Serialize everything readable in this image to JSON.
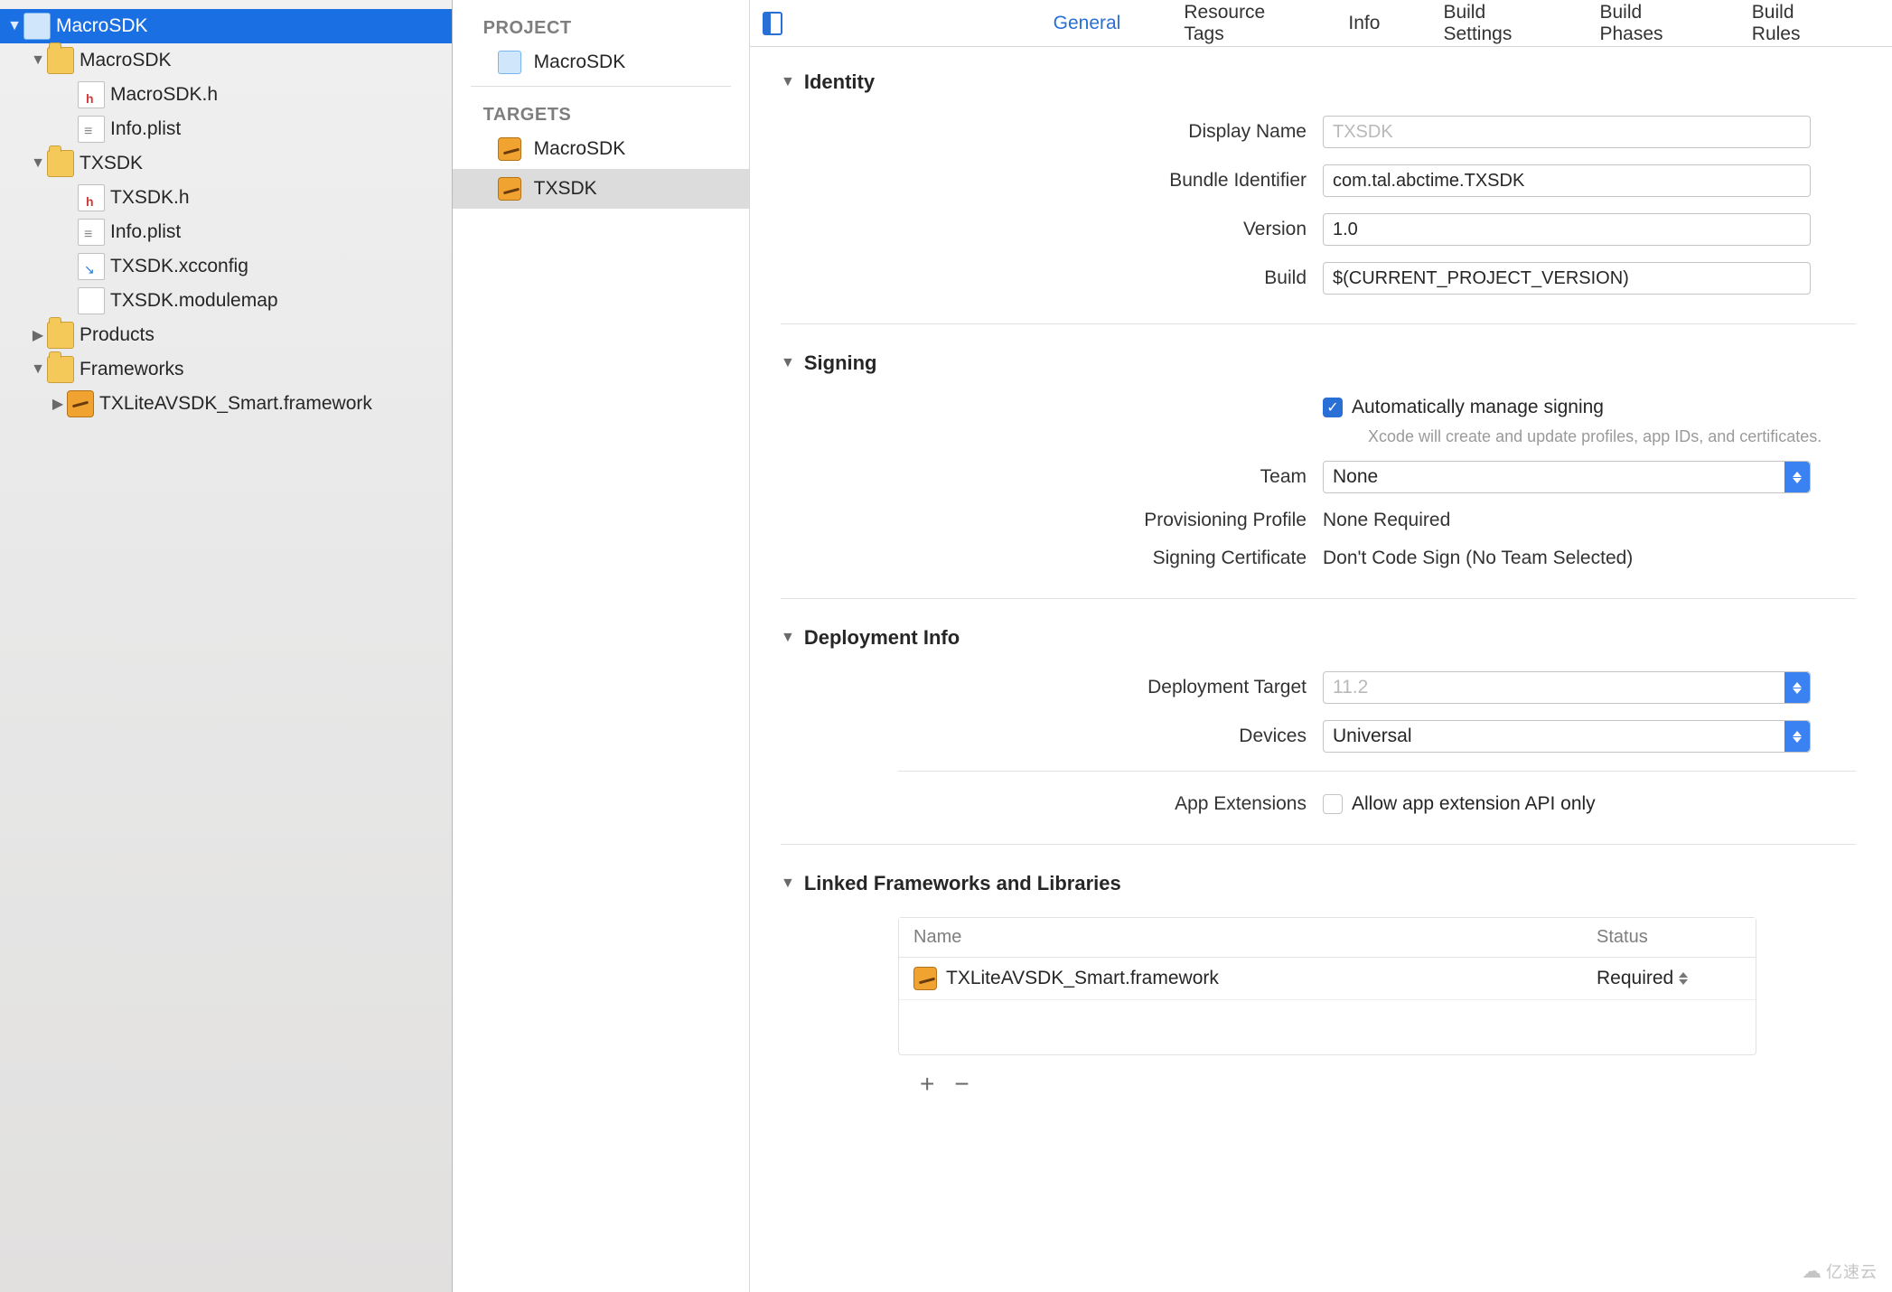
{
  "navigator": {
    "root": "MacroSDK",
    "tree": [
      {
        "label": "MacroSDK",
        "children": [
          "MacroSDK.h",
          "Info.plist"
        ]
      },
      {
        "label": "TXSDK",
        "children": [
          "TXSDK.h",
          "Info.plist",
          "TXSDK.xcconfig",
          "TXSDK.modulemap"
        ]
      },
      {
        "label": "Products"
      },
      {
        "label": "Frameworks",
        "children": [
          "TXLiteAVSDK_Smart.framework"
        ]
      }
    ]
  },
  "mid": {
    "project_header": "PROJECT",
    "project": "MacroSDK",
    "targets_header": "TARGETS",
    "targets": [
      "MacroSDK",
      "TXSDK"
    ],
    "selected": "TXSDK"
  },
  "tabs": [
    "General",
    "Resource Tags",
    "Info",
    "Build Settings",
    "Build Phases",
    "Build Rules"
  ],
  "active_tab": "General",
  "identity": {
    "header": "Identity",
    "display_name_label": "Display Name",
    "display_name_placeholder": "TXSDK",
    "bundle_id_label": "Bundle Identifier",
    "bundle_id": "com.tal.abctime.TXSDK",
    "version_label": "Version",
    "version": "1.0",
    "build_label": "Build",
    "build": "$(CURRENT_PROJECT_VERSION)"
  },
  "signing": {
    "header": "Signing",
    "auto_label": "Automatically manage signing",
    "auto_sub": "Xcode will create and update profiles, app IDs, and certificates.",
    "team_label": "Team",
    "team_value": "None",
    "prov_label": "Provisioning Profile",
    "prov_value": "None Required",
    "cert_label": "Signing Certificate",
    "cert_value": "Don't Code Sign (No Team Selected)"
  },
  "deploy": {
    "header": "Deployment Info",
    "target_label": "Deployment Target",
    "target_placeholder": "11.2",
    "devices_label": "Devices",
    "devices_value": "Universal",
    "ext_label": "App Extensions",
    "ext_check": "Allow app extension API only"
  },
  "linked": {
    "header": "Linked Frameworks and Libraries",
    "col_name": "Name",
    "col_status": "Status",
    "rows": [
      {
        "name": "TXLiteAVSDK_Smart.framework",
        "status": "Required"
      }
    ]
  },
  "watermark": "亿速云"
}
